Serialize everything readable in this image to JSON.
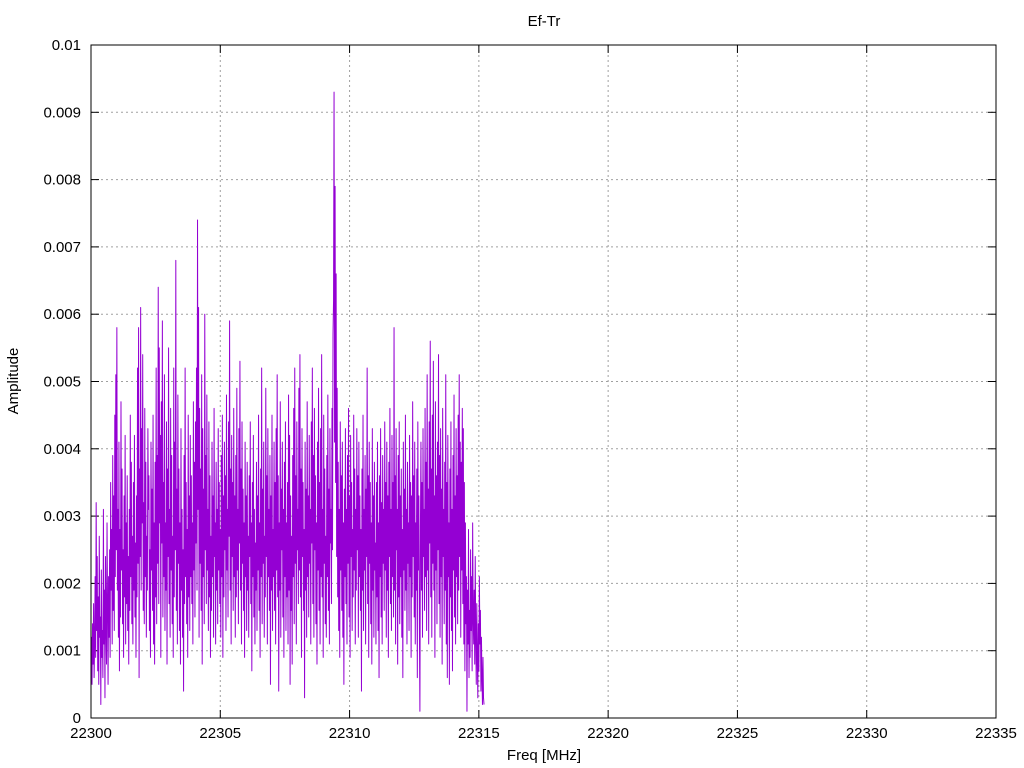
{
  "chart_data": {
    "type": "line",
    "title": "Ef-Tr",
    "xlabel": "Freq [MHz]",
    "ylabel": "Amplitude",
    "xlim": [
      22300,
      22335
    ],
    "ylim": [
      0,
      0.01
    ],
    "xticks": [
      22300,
      22305,
      22310,
      22315,
      22320,
      22325,
      22330,
      22335
    ],
    "xtick_labels": [
      "22300",
      "22305",
      "22310",
      "22315",
      "22320",
      "22325",
      "22330",
      "22335"
    ],
    "yticks": [
      0,
      0.001,
      0.002,
      0.003,
      0.004,
      0.005,
      0.006,
      0.007,
      0.008,
      0.009,
      0.01
    ],
    "ytick_labels": [
      "0",
      "0.001",
      "0.002",
      "0.003",
      "0.004",
      "0.005",
      "0.006",
      "0.007",
      "0.008",
      "0.009",
      "0.01"
    ],
    "grid": true,
    "series_color": "#9400d3",
    "series": [
      {
        "x_start": 22300,
        "x_step": 0.02,
        "values": [
          0.0009,
          0.0012,
          0.0005,
          0.0014,
          0.0008,
          0.0017,
          0.0006,
          0.0011,
          0.0021,
          0.0009,
          0.0032,
          0.0013,
          0.0024,
          0.0007,
          0.0018,
          0.0005,
          0.0027,
          0.0012,
          0.0015,
          0.0002,
          0.0022,
          0.0009,
          0.0013,
          0.0006,
          0.0031,
          0.0011,
          0.0019,
          0.0003,
          0.0024,
          0.0014,
          0.0008,
          0.0029,
          0.0017,
          0.0005,
          0.0021,
          0.0012,
          0.0025,
          0.0009,
          0.0035,
          0.0019,
          0.0028,
          0.0011,
          0.0039,
          0.0016,
          0.0033,
          0.0013,
          0.0045,
          0.0021,
          0.0051,
          0.0025,
          0.0058,
          0.0019,
          0.0031,
          0.0012,
          0.0041,
          0.0007,
          0.0028,
          0.0015,
          0.0047,
          0.0022,
          0.0037,
          0.0014,
          0.0025,
          0.0009,
          0.0033,
          0.0018,
          0.0042,
          0.0011,
          0.0029,
          0.0017,
          0.0036,
          0.0013,
          0.0024,
          0.0008,
          0.0031,
          0.0016,
          0.0045,
          0.0021,
          0.0038,
          0.0014,
          0.0027,
          0.0011,
          0.0035,
          0.0019,
          0.0042,
          0.0015,
          0.0026,
          0.0009,
          0.0033,
          0.0018,
          0.0052,
          0.0023,
          0.0058,
          0.0006,
          0.0037,
          0.0024,
          0.0061,
          0.0019,
          0.0043,
          0.0029,
          0.0054,
          0.0016,
          0.0032,
          0.0014,
          0.0046,
          0.0021,
          0.0038,
          0.0012,
          0.0027,
          0.0019,
          0.0043,
          0.0031,
          0.0036,
          0.0013,
          0.0025,
          0.0009,
          0.0041,
          0.0022,
          0.0034,
          0.0016,
          0.0045,
          0.0011,
          0.0029,
          0.0008,
          0.0038,
          0.0018,
          0.0052,
          0.0014,
          0.0039,
          0.0023,
          0.0064,
          0.0017,
          0.0055,
          0.0029,
          0.0042,
          0.0009,
          0.0047,
          0.0026,
          0.0059,
          0.0015,
          0.0035,
          0.0021,
          0.0051,
          0.0013,
          0.0029,
          0.0019,
          0.0044,
          0.0008,
          0.0037,
          0.0024,
          0.0055,
          0.0017,
          0.0031,
          0.0012,
          0.0046,
          0.0022,
          0.0039,
          0.0014,
          0.0027,
          0.0009,
          0.0052,
          0.0018,
          0.0041,
          0.0025,
          0.0068,
          0.0016,
          0.0034,
          0.0011,
          0.0048,
          0.0023,
          0.0037,
          0.0013,
          0.0029,
          0.0008,
          0.0043,
          0.0019,
          0.0031,
          0.0012,
          0.0025,
          0.0004,
          0.0039,
          0.0017,
          0.0052,
          0.0021,
          0.0035,
          0.0014,
          0.0028,
          0.0009,
          0.0045,
          0.0018,
          0.0033,
          0.0013,
          0.0042,
          0.0021,
          0.0036,
          0.0017,
          0.0029,
          0.0011,
          0.0047,
          0.0022,
          0.0038,
          0.0015,
          0.0044,
          0.0026,
          0.0052,
          0.0019,
          0.0074,
          0.0031,
          0.0061,
          0.0012,
          0.0046,
          0.0023,
          0.0037,
          0.0016,
          0.0051,
          0.0008,
          0.0043,
          0.0021,
          0.0034,
          0.0014,
          0.006,
          0.0025,
          0.0039,
          0.0017,
          0.0048,
          0.0022,
          0.0031,
          0.0013,
          0.0044,
          0.0018,
          0.0036,
          0.0009,
          0.0027,
          0.0016,
          0.0041,
          0.0021,
          0.0033,
          0.0012,
          0.0046,
          0.0024,
          0.0029,
          0.0011,
          0.0038,
          0.0019,
          0.0031,
          0.0014,
          0.0043,
          0.0022,
          0.0035,
          0.0017,
          0.0028,
          0.0012,
          0.0039,
          0.0021,
          0.0045,
          0.0009,
          0.0033,
          0.0018,
          0.0041,
          0.0025,
          0.0036,
          0.0013,
          0.0048,
          0.0022,
          0.0031,
          0.0015,
          0.0044,
          0.0027,
          0.0059,
          0.0019,
          0.0037,
          0.0011,
          0.0042,
          0.0024,
          0.0035,
          0.0016,
          0.0046,
          0.0021,
          0.0033,
          0.0012,
          0.0039,
          0.0018,
          0.0049,
          0.0022,
          0.0031,
          0.0014,
          0.0043,
          0.0026,
          0.0053,
          0.0019,
          0.0037,
          0.0011,
          0.0044,
          0.0023,
          0.0034,
          0.0016,
          0.0029,
          0.0009,
          0.0041,
          0.0021,
          0.0033,
          0.0013,
          0.0038,
          0.0019,
          0.0027,
          0.0012,
          0.0036,
          0.0024,
          0.0044,
          0.0017,
          0.0029,
          0.0007,
          0.0035,
          0.0021,
          0.0042,
          0.0015,
          0.0031,
          0.0011,
          0.0026,
          0.0019,
          0.0038,
          0.0013,
          0.0033,
          0.0022,
          0.0045,
          0.0016,
          0.0029,
          0.0009,
          0.0037,
          0.0021,
          0.0052,
          0.0014,
          0.0034,
          0.0023,
          0.0041,
          0.0012,
          0.0027,
          0.0018,
          0.0049,
          0.0024,
          0.0036,
          0.0011,
          0.0043,
          0.0021,
          0.0031,
          0.0016,
          0.0039,
          0.0005,
          0.0033,
          0.0019,
          0.0045,
          0.0013,
          0.0028,
          0.0021,
          0.0041,
          0.0016,
          0.0035,
          0.0011,
          0.0043,
          0.0022,
          0.0051,
          0.0018,
          0.0036,
          0.0004,
          0.0029,
          0.0019,
          0.0047,
          0.0012,
          0.0034,
          0.0025,
          0.0041,
          0.0015,
          0.0031,
          0.0009,
          0.0038,
          0.0021,
          0.0044,
          0.0013,
          0.0029,
          0.0018,
          0.0035,
          0.0011,
          0.0048,
          0.0019,
          0.0042,
          0.0005,
          0.0033,
          0.0016,
          0.0027,
          0.0008,
          0.0039,
          0.0021,
          0.0046,
          0.0014,
          0.0052,
          0.0023,
          0.0036,
          0.0011,
          0.0044,
          0.0025,
          0.0031,
          0.0017,
          0.0049,
          0.0022,
          0.0054,
          0.0018,
          0.0037,
          0.0009,
          0.0043,
          0.0024,
          0.0035,
          0.0016,
          0.0028,
          0.0003,
          0.0041,
          0.0019,
          0.0034,
          0.0012,
          0.0047,
          0.0021,
          0.0033,
          0.0015,
          0.0042,
          0.0023,
          0.0031,
          0.0011,
          0.0044,
          0.0026,
          0.0052,
          0.0017,
          0.0039,
          0.0012,
          0.0046,
          0.0025,
          0.0036,
          0.0014,
          0.0029,
          0.0008,
          0.0041,
          0.0022,
          0.0049,
          0.0016,
          0.0035,
          0.0011,
          0.0043,
          0.0021,
          0.0054,
          0.0018,
          0.0031,
          0.0009,
          0.0045,
          0.0023,
          0.0037,
          0.0014,
          0.0027,
          0.0012,
          0.0039,
          0.0021,
          0.0048,
          0.0016,
          0.0034,
          0.0011,
          0.0043,
          0.0026,
          0.0031,
          0.0017,
          0.0046,
          0.0025,
          0.0057,
          0.0062,
          0.0093,
          0.0041,
          0.0079,
          0.0035,
          0.0066,
          0.0024,
          0.0049,
          0.0018,
          0.0038,
          0.0013,
          0.0031,
          0.0009,
          0.0044,
          0.0022,
          0.0036,
          0.0016,
          0.0041,
          0.0012,
          0.0029,
          0.0005,
          0.0034,
          0.0021,
          0.0043,
          0.0017,
          0.0031,
          0.0011,
          0.0039,
          0.0023,
          0.0046,
          0.0015,
          0.0033,
          0.0009,
          0.0042,
          0.0024,
          0.0035,
          0.0013,
          0.0028,
          0.0018,
          0.0045,
          0.0022,
          0.0037,
          0.0011,
          0.0031,
          0.0019,
          0.0043,
          0.0025,
          0.0036,
          0.0012,
          0.0041,
          0.0021,
          0.0033,
          0.0016,
          0.0028,
          0.0004,
          0.0037,
          0.0019,
          0.0045,
          0.0013,
          0.0031,
          0.0022,
          0.0039,
          0.0011,
          0.0034,
          0.0024,
          0.0052,
          0.0017,
          0.0036,
          0.0009,
          0.0041,
          0.0023,
          0.0035,
          0.0014,
          0.0029,
          0.0008,
          0.0043,
          0.0019,
          0.0033,
          0.0012,
          0.0038,
          0.0022,
          0.0026,
          0.0011,
          0.0035,
          0.0018,
          0.0041,
          0.0013,
          0.0029,
          0.0006,
          0.0036,
          0.0021,
          0.0043,
          0.0015,
          0.0032,
          0.0011,
          0.0039,
          0.0023,
          0.0031,
          0.0016,
          0.0044,
          0.0022,
          0.0035,
          0.0012,
          0.0041,
          0.0019,
          0.0033,
          0.0009,
          0.0038,
          0.0024,
          0.0046,
          0.0017,
          0.0031,
          0.0013,
          0.0042,
          0.0021,
          0.0035,
          0.0015,
          0.0058,
          0.0019,
          0.0036,
          0.0011,
          0.0043,
          0.0025,
          0.0031,
          0.0008,
          0.0039,
          0.0018,
          0.0044,
          0.0014,
          0.0033,
          0.0021,
          0.0037,
          0.0012,
          0.0028,
          0.0006,
          0.0041,
          0.0022,
          0.0034,
          0.0016,
          0.0045,
          0.0019,
          0.0031,
          0.0011,
          0.0038,
          0.0023,
          0.0029,
          0.0013,
          0.0042,
          0.0021,
          0.0035,
          0.0009,
          0.0033,
          0.0018,
          0.0047,
          0.0024,
          0.0036,
          0.0015,
          0.0041,
          0.0011,
          0.0029,
          0.0019,
          0.0037,
          0.0006,
          0.0044,
          0.0022,
          0.0033,
          0.0014,
          0.0001,
          0.0028,
          0.0041,
          0.0019,
          0.0035,
          0.0012,
          0.0043,
          0.0024,
          0.0031,
          0.0016,
          0.0046,
          0.0021,
          0.0038,
          0.0013,
          0.0051,
          0.0022,
          0.0034,
          0.0011,
          0.0044,
          0.0026,
          0.0056,
          0.0018,
          0.0037,
          0.0012,
          0.0045,
          0.0023,
          0.0053,
          0.0019,
          0.0033,
          0.0009,
          0.0047,
          0.0022,
          0.0036,
          0.0014,
          0.0041,
          0.0025,
          0.0054,
          0.0017,
          0.0039,
          0.0012,
          0.0043,
          0.0021,
          0.0034,
          0.0008,
          0.0046,
          0.0024,
          0.0031,
          0.0014,
          0.0038,
          0.0019,
          0.0051,
          0.0011,
          0.0035,
          0.0006,
          0.0042,
          0.0021,
          0.0029,
          0.0005,
          0.0037,
          0.0018,
          0.0044,
          0.0013,
          0.0031,
          0.0007,
          0.0039,
          0.0022,
          0.0048,
          0.0015,
          0.0033,
          0.0011,
          0.0043,
          0.0021,
          0.0036,
          0.0014,
          0.0045,
          0.0019,
          0.0051,
          0.0024,
          0.0041,
          0.0012,
          0.0038,
          0.0022,
          0.0046,
          0.0017,
          0.0043,
          0.0011,
          0.0035,
          0.0007,
          0.0029,
          0.0014,
          0.0021,
          0.0001,
          0.0019,
          0.0011,
          0.0028,
          0.0006,
          0.0016,
          0.0009,
          0.0025,
          0.0013,
          0.0021,
          0.0007,
          0.0029,
          0.0015,
          0.0011,
          0.0019,
          0.0008,
          0.0024,
          0.0012,
          0.0005,
          0.0017,
          0.0009,
          0.0003,
          0.0014,
          0.0007,
          0.0021,
          0.0011,
          0.0016,
          0.0004,
          0.0012,
          0.0006,
          0.0002,
          0.0009,
          0.0003,
          0.0002
        ]
      }
    ]
  }
}
